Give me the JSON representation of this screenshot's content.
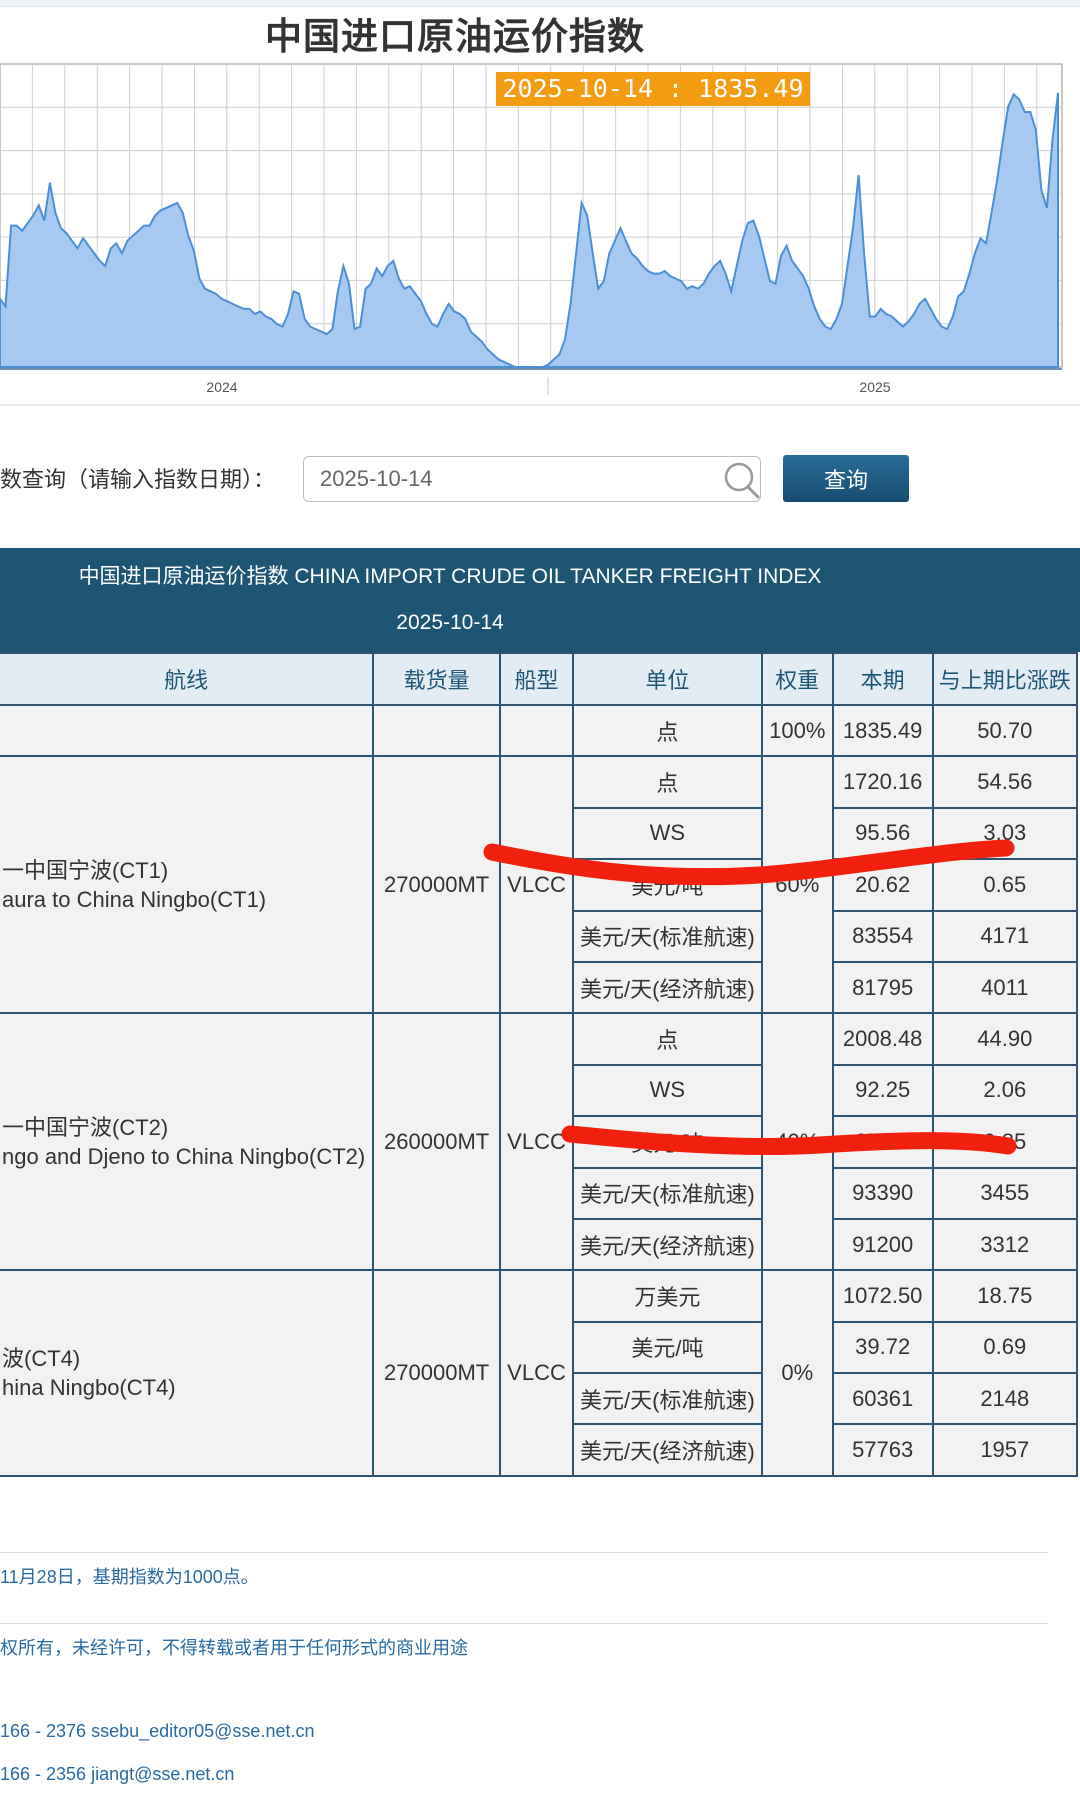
{
  "page": {
    "chart_title": "中国进口原油运价指数",
    "tooltip": "2025-10-14 : 1835.49"
  },
  "chart_data": {
    "type": "area",
    "x_ticks": [
      "2024",
      "2025"
    ],
    "highlight": {
      "date": "2025-10-14",
      "value": 1835.49
    },
    "color": "#a7c8f0",
    "line_color": "#4d8fd4",
    "series": [
      {
        "values": [
          1020,
          990,
          1310,
          1310,
          1290,
          1320,
          1350,
          1390,
          1330,
          1480,
          1360,
          1300,
          1280,
          1250,
          1220,
          1260,
          1230,
          1200,
          1170,
          1150,
          1220,
          1240,
          1200,
          1250,
          1270,
          1290,
          1310,
          1310,
          1350,
          1370,
          1380,
          1390,
          1400,
          1360,
          1270,
          1210,
          1100,
          1060,
          1050,
          1040,
          1020,
          1010,
          1000,
          990,
          980,
          980,
          960,
          970,
          950,
          940,
          920,
          910,
          960,
          1050,
          1040,
          940,
          910,
          900,
          890,
          880,
          900,
          1050,
          1150,
          1080,
          900,
          910,
          1060,
          1080,
          1140,
          1110,
          1150,
          1170,
          1100,
          1060,
          1070,
          1040,
          1010,
          960,
          920,
          910,
          960,
          1000,
          970,
          960,
          940,
          890,
          870,
          850,
          820,
          800,
          780,
          770,
          760,
          730,
          700,
          690,
          700,
          720,
          730,
          760,
          780,
          800,
          860,
          1000,
          1200,
          1400,
          1350,
          1200,
          1060,
          1090,
          1200,
          1250,
          1300,
          1250,
          1200,
          1180,
          1150,
          1130,
          1120,
          1120,
          1130,
          1110,
          1100,
          1090,
          1060,
          1070,
          1060,
          1080,
          1120,
          1150,
          1170,
          1120,
          1050,
          1150,
          1250,
          1320,
          1330,
          1270,
          1180,
          1090,
          1080,
          1190,
          1230,
          1170,
          1140,
          1110,
          1060,
          990,
          940,
          910,
          900,
          940,
          1000,
          1150,
          1300,
          1510,
          1200,
          950,
          950,
          980,
          960,
          950,
          930,
          910,
          930,
          960,
          1000,
          1020,
          980,
          940,
          910,
          900,
          950,
          1030,
          1050,
          1120,
          1200,
          1260,
          1240,
          1360,
          1490,
          1640,
          1780,
          1830,
          1810,
          1760,
          1760,
          1690,
          1450,
          1380,
          1650,
          1835.49
        ]
      }
    ],
    "x_range": [
      0,
      1
    ],
    "y_range": [
      750,
      1950
    ]
  },
  "query": {
    "label": "数查询（请输入指数日期）：",
    "value": "2025-10-14",
    "button": "查询"
  },
  "table": {
    "header_title": "中国进口原油运价指数 CHINA IMPORT CRUDE OIL TANKER FREIGHT INDEX",
    "header_date": "2025-10-14",
    "columns": [
      "航线",
      "载货量",
      "船型",
      "单位",
      "权重",
      "本期",
      "与上期比涨跌"
    ],
    "index_row": {
      "unit": "点",
      "weight": "100%",
      "current": "1835.49",
      "change": "50.70"
    },
    "groups": [
      {
        "route_cn": "一中国宁波(CT1)",
        "route_en": "aura to China Ningbo(CT1)",
        "cargo": "270000MT",
        "ship": "VLCC",
        "weight": "60%",
        "rows": [
          {
            "unit": "点",
            "current": "1720.16",
            "change": "54.56"
          },
          {
            "unit": "WS",
            "current": "95.56",
            "change": "3.03"
          },
          {
            "unit": "美元/吨",
            "current": "20.62",
            "change": "0.65"
          },
          {
            "unit": "美元/天(标准航速)",
            "current": "83554",
            "change": "4171"
          },
          {
            "unit": "美元/天(经济航速)",
            "current": "81795",
            "change": "4011"
          }
        ]
      },
      {
        "route_cn": "一中国宁波(CT2)",
        "route_en": "ngo and Djeno to China Ningbo(CT2)",
        "cargo": "260000MT",
        "ship": "VLCC",
        "weight": "40%",
        "rows": [
          {
            "unit": "点",
            "current": "2008.48",
            "change": "44.90"
          },
          {
            "unit": "WS",
            "current": "92.25",
            "change": "2.06"
          },
          {
            "unit": "美元/吨",
            "current": "37.88",
            "change": "0.85"
          },
          {
            "unit": "美元/天(标准航速)",
            "current": "93390",
            "change": "3455"
          },
          {
            "unit": "美元/天(经济航速)",
            "current": "91200",
            "change": "3312"
          }
        ]
      },
      {
        "route_cn": "波(CT4)",
        "route_en": "hina Ningbo(CT4)",
        "cargo": "270000MT",
        "ship": "VLCC",
        "weight": "0%",
        "rows": [
          {
            "unit": "万美元",
            "current": "1072.50",
            "change": "18.75"
          },
          {
            "unit": "美元/吨",
            "current": "39.72",
            "change": "0.69"
          },
          {
            "unit": "美元/天(标准航速)",
            "current": "60361",
            "change": "2148"
          },
          {
            "unit": "美元/天(经济航速)",
            "current": "57763",
            "change": "1957"
          }
        ]
      }
    ]
  },
  "footer": {
    "note": "11月28日，基期指数为1000点。",
    "copyright": "权所有，未经许可，不得转载或者用于任何形式的商业用途",
    "contact1": "166 - 2376 ssebu_editor05@sse.net.cn",
    "contact2": "166 - 2356 jiangt@sse.net.cn"
  },
  "annotations": {
    "marker_color": "#f2200f"
  }
}
